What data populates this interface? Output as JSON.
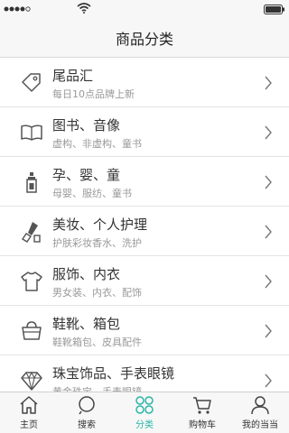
{
  "nav": {
    "title": "商品分类"
  },
  "categories": [
    {
      "title": "尾品汇",
      "subtitle": "每日10点品牌上新",
      "icon": "price-tag-icon"
    },
    {
      "title": "图书、音像",
      "subtitle": "虚构、非虚构、童书",
      "icon": "open-book-icon"
    },
    {
      "title": "孕、婴、童",
      "subtitle": "母婴、服纺、童书",
      "icon": "baby-bottle-icon"
    },
    {
      "title": "美妆、个人护理",
      "subtitle": "护肤彩妆香水、洗护",
      "icon": "lipstick-icon"
    },
    {
      "title": "服饰、内衣",
      "subtitle": "男女装、内衣、配饰",
      "icon": "t-shirt-icon"
    },
    {
      "title": "鞋靴、箱包",
      "subtitle": "鞋靴箱包、皮具配件",
      "icon": "handbag-icon"
    },
    {
      "title": "珠宝饰品、手表眼镜",
      "subtitle": "黄金珠宝、手表眼镜",
      "icon": "diamond-icon"
    }
  ],
  "tabs": [
    {
      "label": "主页",
      "icon": "home-icon",
      "active": false
    },
    {
      "label": "搜索",
      "icon": "search-icon",
      "active": false
    },
    {
      "label": "分类",
      "icon": "category-grid-icon",
      "active": true
    },
    {
      "label": "购物车",
      "icon": "cart-icon",
      "active": false
    },
    {
      "label": "我的当当",
      "icon": "user-icon",
      "active": false
    }
  ],
  "colors": {
    "accent": "#2bb5a8",
    "icon": "#555555"
  }
}
